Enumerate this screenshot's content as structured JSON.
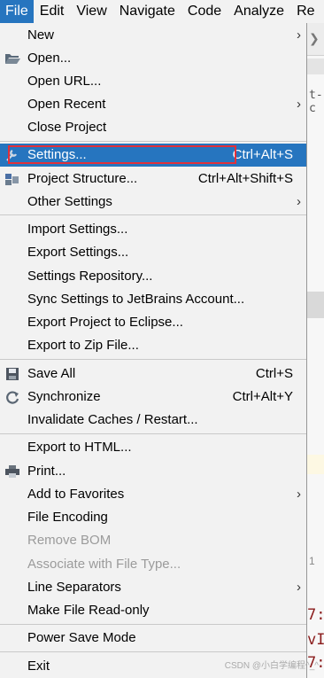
{
  "menubar": {
    "items": [
      "File",
      "Edit",
      "View",
      "Navigate",
      "Code",
      "Analyze",
      "Re"
    ]
  },
  "menu": {
    "items": {
      "new": {
        "label": "New"
      },
      "open": {
        "label": "Open..."
      },
      "open_url": {
        "label": "Open URL..."
      },
      "open_recent": {
        "label": "Open Recent"
      },
      "close_project": {
        "label": "Close Project"
      },
      "settings": {
        "label": "Settings...",
        "shortcut": "Ctrl+Alt+S"
      },
      "project_structure": {
        "label": "Project Structure...",
        "shortcut": "Ctrl+Alt+Shift+S"
      },
      "other_settings": {
        "label": "Other Settings"
      },
      "import_settings": {
        "label": "Import Settings..."
      },
      "export_settings": {
        "label": "Export Settings..."
      },
      "settings_repository": {
        "label": "Settings Repository..."
      },
      "sync_settings": {
        "label": "Sync Settings to JetBrains Account..."
      },
      "export_eclipse": {
        "label": "Export Project to Eclipse..."
      },
      "export_zip": {
        "label": "Export to Zip File..."
      },
      "save_all": {
        "label": "Save All",
        "shortcut": "Ctrl+S"
      },
      "synchronize": {
        "label": "Synchronize",
        "shortcut": "Ctrl+Alt+Y"
      },
      "invalidate_caches": {
        "label": "Invalidate Caches / Restart..."
      },
      "export_html": {
        "label": "Export to HTML..."
      },
      "print": {
        "label": "Print..."
      },
      "add_favorites": {
        "label": "Add to Favorites"
      },
      "file_encoding": {
        "label": "File Encoding"
      },
      "remove_bom": {
        "label": "Remove BOM"
      },
      "associate_file_type": {
        "label": "Associate with File Type..."
      },
      "line_separators": {
        "label": "Line Separators"
      },
      "make_read_only": {
        "label": "Make File Read-only"
      },
      "power_save": {
        "label": "Power Save Mode"
      },
      "exit": {
        "label": "Exit"
      }
    }
  },
  "editor": {
    "breadcrumb_fragment": "t-c",
    "gutter_fragment": "1",
    "code_lines": [
      "7:",
      "vI",
      "7:"
    ]
  },
  "watermark": "CSDN @小白学编程^_^",
  "colors": {
    "selection": "#2675bf",
    "highlight_box": "#e0303a",
    "disabled_text": "#9b9b9b"
  }
}
